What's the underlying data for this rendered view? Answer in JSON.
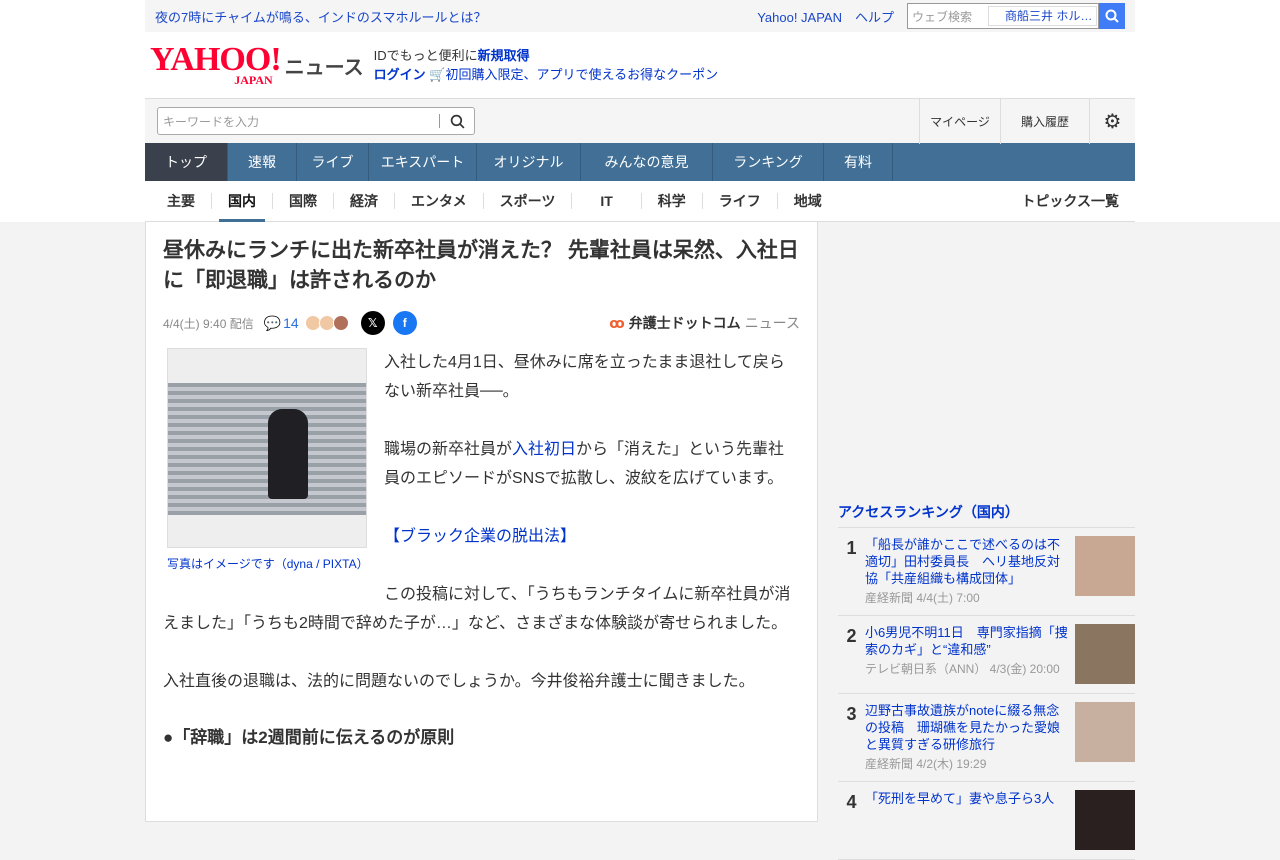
{
  "topbar": {
    "headline": "夜の7時にチャイムが鳴る、インドのスマホルールとは？",
    "links": [
      "Yahoo! JAPAN",
      "ヘルプ"
    ],
    "search_placeholder": "ウェブ検索",
    "search_suggest": "商船三井 ホル…"
  },
  "header": {
    "logo_text": "YAHOO!",
    "logo_sub": "JAPAN",
    "service": "ニュース",
    "id_text": "IDでもっと便利に",
    "signup": "新規取得",
    "login": "ログイン",
    "coupon": "初回購入限定、アプリで使えるお得なクーポン"
  },
  "search": {
    "placeholder": "キーワードを入力",
    "mypage": "マイページ",
    "history": "購入履歴"
  },
  "nav": [
    "トップ",
    "速報",
    "ライブ",
    "エキスパート",
    "オリジナル",
    "みんなの意見",
    "ランキング",
    "有料"
  ],
  "subnav": [
    "主要",
    "国内",
    "国際",
    "経済",
    "エンタメ",
    "スポーツ",
    "IT",
    "科学",
    "ライフ",
    "地域"
  ],
  "subnav_all": "トピックス一覧",
  "article": {
    "title": "昼休みにランチに出た新卒社員が消えた？ 先輩社員は呆然、入社日に「即退職」は許されるのか",
    "date": "4/4(土) 9:40 配信",
    "comments": "14",
    "source": "弁護士ドットコム",
    "source_suffix": "ニュース",
    "caption": "写真はイメージです（dyna / PIXTA）",
    "p1": "入社した4月1日、昼休みに席を立ったまま退社して戻らない新卒社員──。",
    "p2a": "職場の新卒社員が",
    "p2link": "入社初日",
    "p2b": "から「消えた」という先輩社員のエピソードがSNSで拡散し、波紋を広げています。",
    "link": "【ブラック企業の脱出法】",
    "p3": "この投稿に対して、「うちもランチタイムに新卒社員が消えました」「うちも2時間で辞めた子が…」など、さまざまな体験談が寄せられました。",
    "p4": "入社直後の退職は、法的に問題ないのでしょうか。今井俊裕弁護士に聞きました。",
    "h3": "●「辞職」は2週間前に伝えるのが原則"
  },
  "ranking": {
    "title": "アクセスランキング（国内）",
    "items": [
      {
        "num": "1",
        "title": "「船長が誰かここで述べるのは不適切」田村委員長　ヘリ基地反対協「共産組織も構成団体」",
        "meta": "産経新聞 4/4(土) 7:00",
        "color": "#c9a893"
      },
      {
        "num": "2",
        "title": "小6男児不明11日　専門家指摘「捜索のカギ」と“違和感”",
        "meta": "テレビ朝日系（ANN） 4/3(金) 20:00",
        "color": "#8a7560"
      },
      {
        "num": "3",
        "title": "辺野古事故遺族がnoteに綴る無念の投稿　珊瑚礁を見たかった愛娘と異質すぎる研修旅行",
        "meta": "産経新聞 4/2(木) 19:29",
        "color": "#c7b0a0"
      },
      {
        "num": "4",
        "title": "「死刑を早めて」妻や息子ら3人",
        "meta": "",
        "color": "#2a2020"
      }
    ]
  }
}
